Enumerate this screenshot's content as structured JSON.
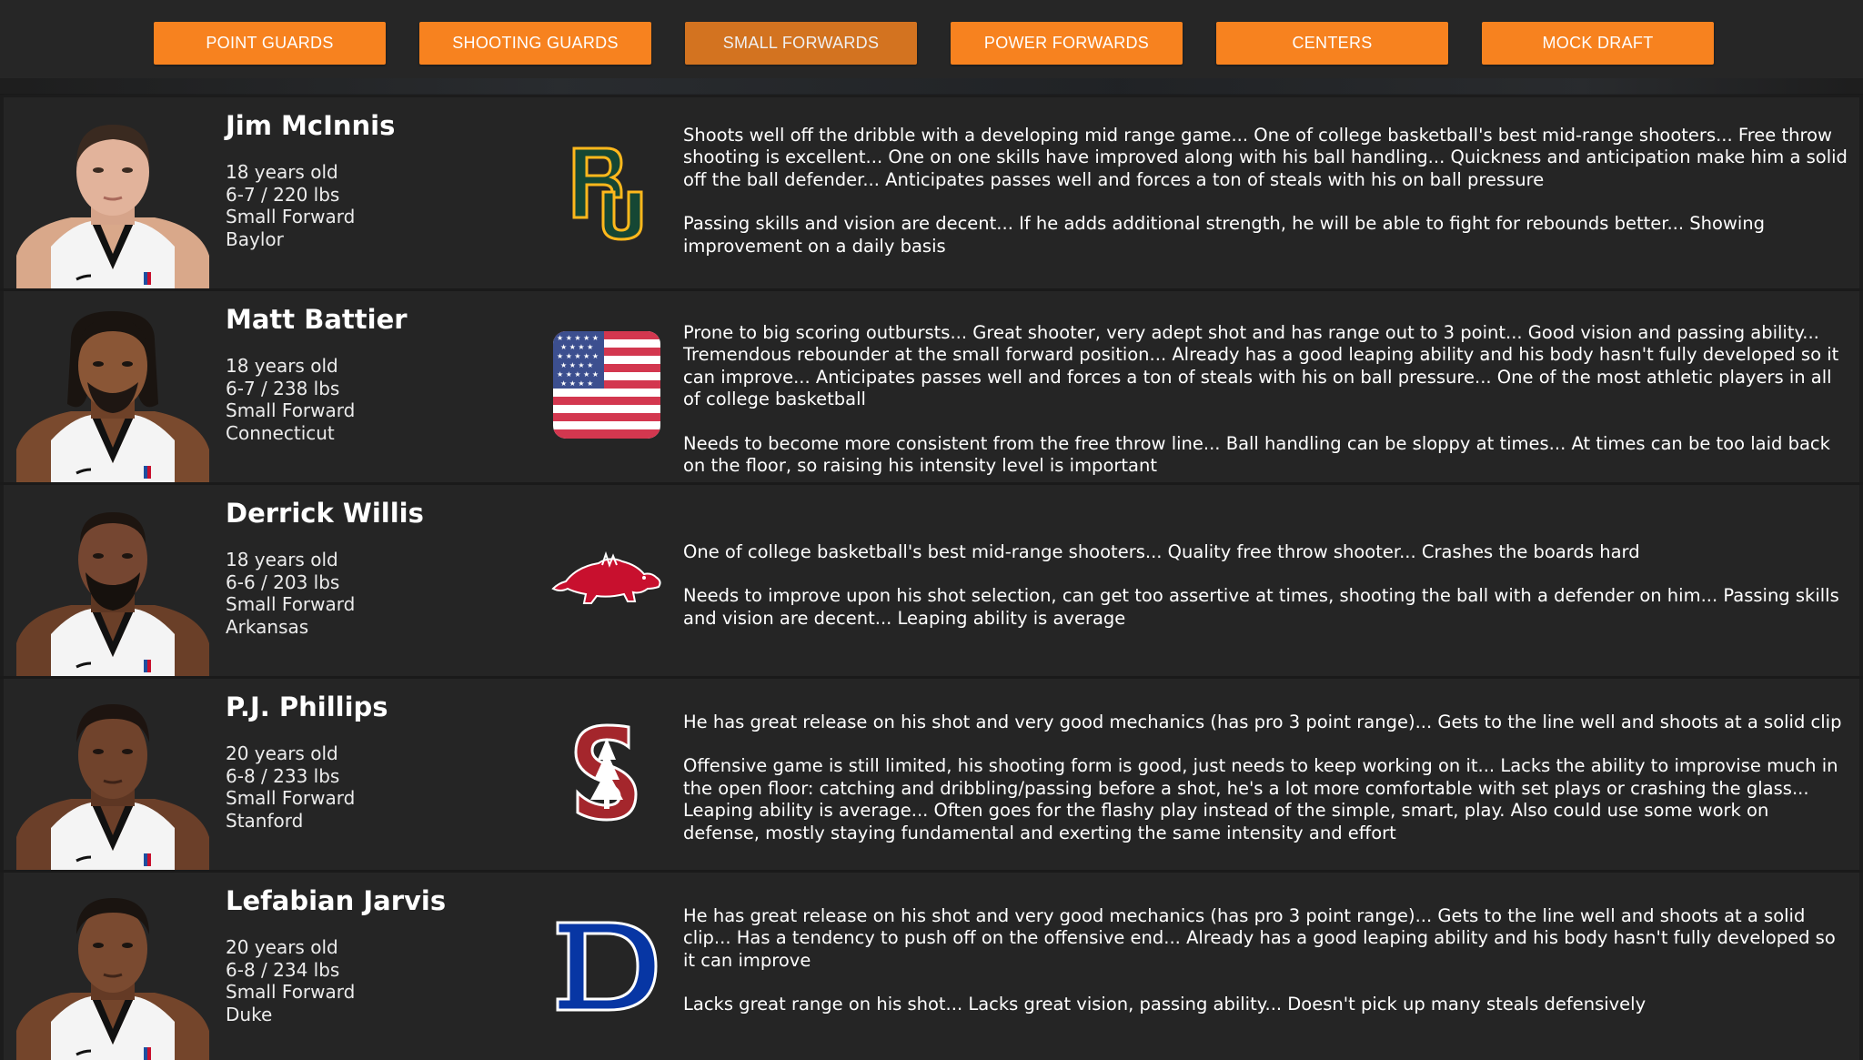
{
  "nav": {
    "tabs": [
      {
        "label": "POINT GUARDS",
        "active": false
      },
      {
        "label": "SHOOTING GUARDS",
        "active": false
      },
      {
        "label": "SMALL FORWARDS",
        "active": true
      },
      {
        "label": "POWER FORWARDS",
        "active": false
      },
      {
        "label": "CENTERS",
        "active": false
      },
      {
        "label": "MOCK DRAFT",
        "active": false
      }
    ]
  },
  "colors": {
    "accent": "#f7821f",
    "background": "#1c1c1c",
    "row_background": "#252525"
  },
  "players": [
    {
      "name": "Jim McInnis",
      "age": "18 years old",
      "size": "6-7 / 220 lbs",
      "position": "Small Forward",
      "school": "Baylor",
      "logo_icon": "baylor-logo-icon",
      "strengths": "Shoots well off the dribble with a developing mid range game... One of college basketball's best mid-range shooters... Free throw shooting is excellent... One on one skills have improved along with his ball handling... Quickness and anticipation make him a solid off the ball defender... Anticipates passes well and forces a ton of steals with his on ball pressure",
      "weaknesses": "Passing skills and vision are decent... If he adds additional strength, he will be able to fight for rebounds better... Showing improvement on a daily basis"
    },
    {
      "name": "Matt Battier",
      "age": "18 years old",
      "size": "6-7 / 238 lbs",
      "position": "Small Forward",
      "school": "Connecticut",
      "logo_icon": "us-flag-icon",
      "strengths": "Prone to big scoring outbursts... Great shooter, very adept shot and has range out to 3 point... Good vision and passing ability... Tremendous rebounder at the small forward position... Already has a good leaping ability and his body hasn't fully developed so it can improve... Anticipates passes well and forces a ton of steals with his on ball pressure... One of the most athletic players in all of college basketball",
      "weaknesses": "Needs to become more consistent from the free throw line... Ball handling can be sloppy at times... At times can be too laid back on the floor, so raising his intensity level is important"
    },
    {
      "name": "Derrick Willis",
      "age": "18 years old",
      "size": "6-6 / 203 lbs",
      "position": "Small Forward",
      "school": "Arkansas",
      "logo_icon": "razorback-logo-icon",
      "strengths": "One of college basketball's best mid-range shooters... Quality free throw shooter... Crashes the boards hard",
      "weaknesses": "Needs to improve upon his shot selection, can get too assertive at times, shooting the ball with a defender on him... Passing skills and vision are decent... Leaping ability is average"
    },
    {
      "name": "P.J. Phillips",
      "age": "20 years old",
      "size": "6-8 / 233 lbs",
      "position": "Small Forward",
      "school": "Stanford",
      "logo_icon": "stanford-logo-icon",
      "strengths": "He has great release on his shot and very good mechanics (has pro 3 point range)... Gets to the line well and shoots at a solid clip",
      "weaknesses": "Offensive game is still limited, his shooting form is good, just needs to keep working on it... Lacks the ability to improvise much in the open floor: catching and dribbling/passing before a shot, he's a lot more comfortable with set plays or crashing the glass... Leaping ability is average... Often goes for the flashy play instead of the simple, smart, play. Also could use some work on defense, mostly staying fundamental and exerting the same intensity and effort"
    },
    {
      "name": "Lefabian Jarvis",
      "age": "20 years old",
      "size": "6-8 / 234 lbs",
      "position": "Small Forward",
      "school": "Duke",
      "logo_icon": "duke-logo-icon",
      "strengths": "He has great release on his shot and very good mechanics (has pro 3 point range)... Gets to the line well and shoots at a solid clip... Has a tendency to push off on the offensive end... Already has a good leaping ability and his body hasn't fully developed so it can improve",
      "weaknesses": "Lacks great range on his shot... Lacks great vision, passing ability... Doesn't pick up many steals defensively"
    }
  ]
}
